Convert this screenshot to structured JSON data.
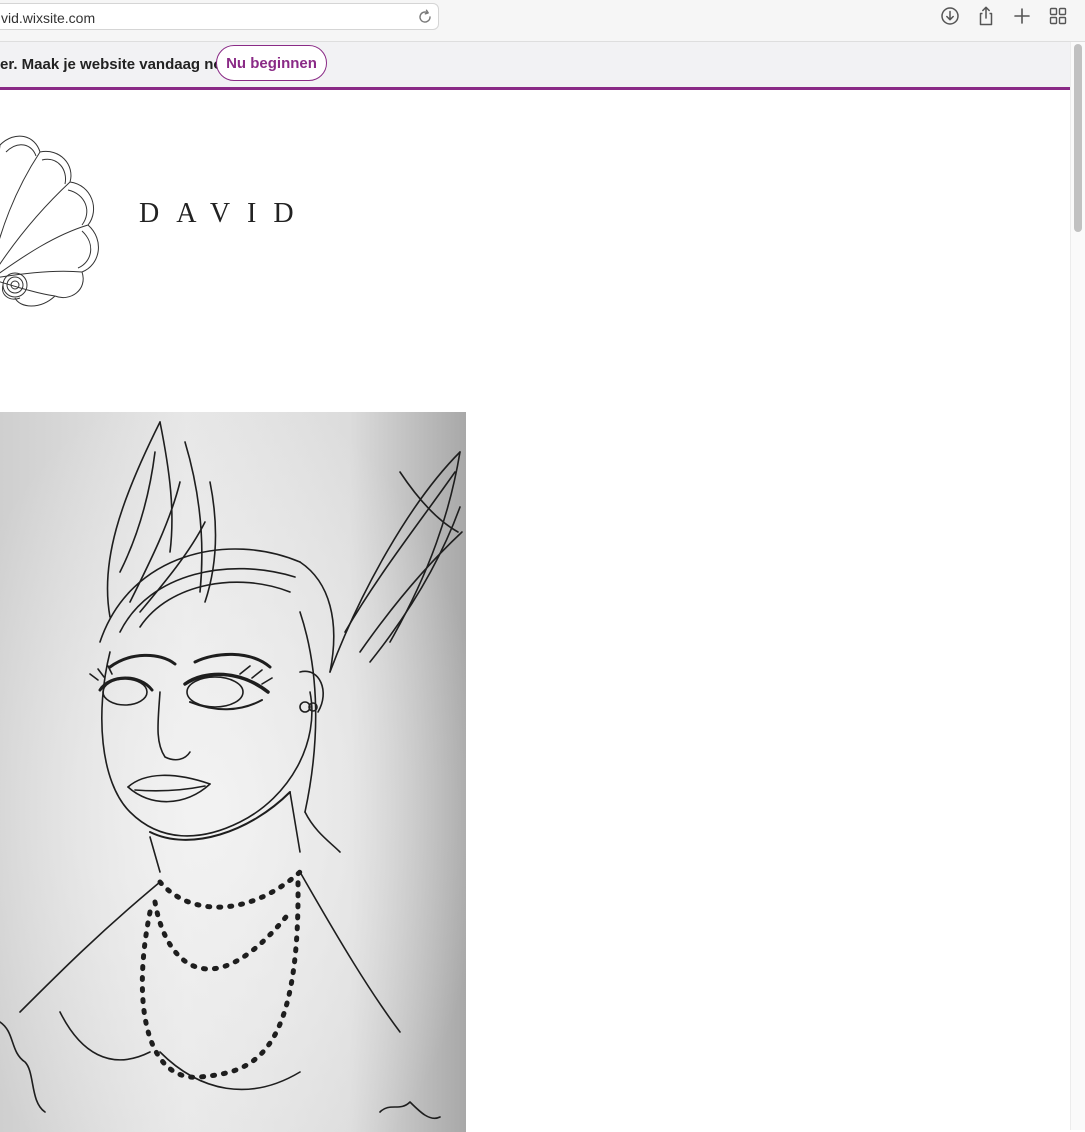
{
  "browser": {
    "address": "vid.wixsite.com",
    "icons": {
      "reload": "reload-icon",
      "download": "download-icon",
      "share": "share-icon",
      "new_tab": "plus-icon",
      "tab_overview": "grid-icon"
    }
  },
  "banner": {
    "message": "er. Maak je website vandaag nog.",
    "button_label": "Nu beginnen",
    "accent_color": "#8a2a86"
  },
  "site": {
    "title": "DAVID",
    "logo_icon": "shell-logo-icon"
  }
}
